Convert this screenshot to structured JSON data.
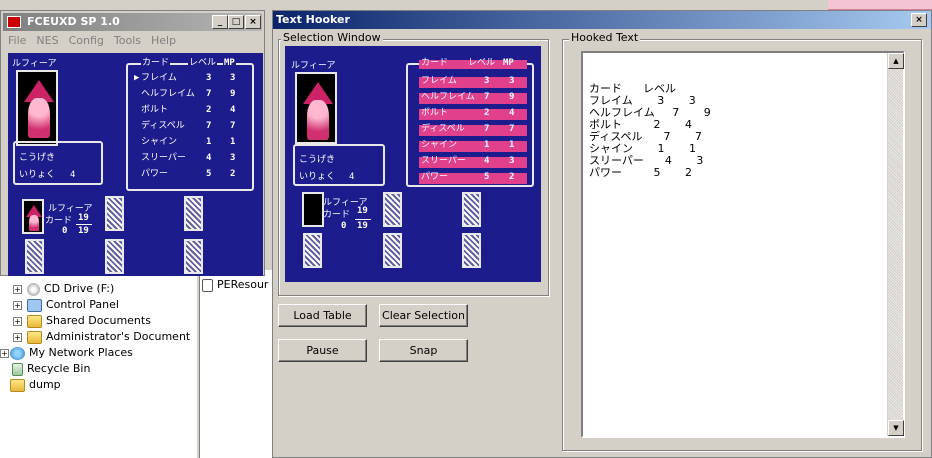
{
  "fceux": {
    "title": "FCEUXD SP 1.0",
    "menu": [
      "File",
      "NES",
      "Config",
      "Tools",
      "Help"
    ],
    "min_glyph": "_",
    "max_glyph": "□",
    "close_glyph": "×"
  },
  "game": {
    "character": "ルフィーア",
    "attack_label": "こうげき",
    "magic_label": "いりょく",
    "magic_value": "4",
    "header": [
      "カード",
      "レベル",
      "MP"
    ],
    "spells": [
      {
        "name": "フレイム",
        "level": "3",
        "mp": "3"
      },
      {
        "name": "ヘルフレイム",
        "level": "7",
        "mp": "9"
      },
      {
        "name": "ボルト",
        "level": "2",
        "mp": "4"
      },
      {
        "name": "ディスペル",
        "level": "7",
        "mp": "7"
      },
      {
        "name": "シャイン",
        "level": "1",
        "mp": "1"
      },
      {
        "name": "スリーパー",
        "level": "4",
        "mp": "3"
      },
      {
        "name": "パワー",
        "level": "5",
        "mp": "2"
      }
    ],
    "cursor": "▶",
    "card_label": "カード",
    "card_count_top": "19",
    "card_count_left": "0",
    "card_count_bottom": "19"
  },
  "explorer": {
    "items": [
      {
        "label": "CD Drive (F:)",
        "icon": "cd-drive-icon"
      },
      {
        "label": "Control Panel",
        "icon": "control-panel-icon"
      },
      {
        "label": "Shared Documents",
        "icon": "folder-icon"
      },
      {
        "label": "Administrator's Document",
        "icon": "folder-icon"
      },
      {
        "label": "My Network Places",
        "icon": "network-icon"
      },
      {
        "label": "Recycle Bin",
        "icon": "recycle-bin-icon"
      },
      {
        "label": "dump",
        "icon": "folder-icon"
      }
    ],
    "right_item": "PEResour"
  },
  "hooker": {
    "title": "Text Hooker",
    "close_glyph": "×",
    "selection_label": "Selection Window",
    "hooked_label": "Hooked Text",
    "buttons": {
      "load_table": "Load Table",
      "clear_selection": "Clear Selection",
      "pause": "Pause",
      "snap": "Snap"
    },
    "hooked_lines": [
      "カード      レベル",
      "フレイム       3       3",
      "ヘルフレイム     7       9",
      "ボルト         2       4",
      "ディスペル      7       7",
      "シャイン       1       1",
      "スリーパー      4       3",
      "パワー         5       2"
    ]
  },
  "colors": {
    "nes_blue": "#1c1c8c",
    "highlight_pink": "#e0408c",
    "title_active": "#0a246a",
    "title_inactive": "#808080"
  }
}
